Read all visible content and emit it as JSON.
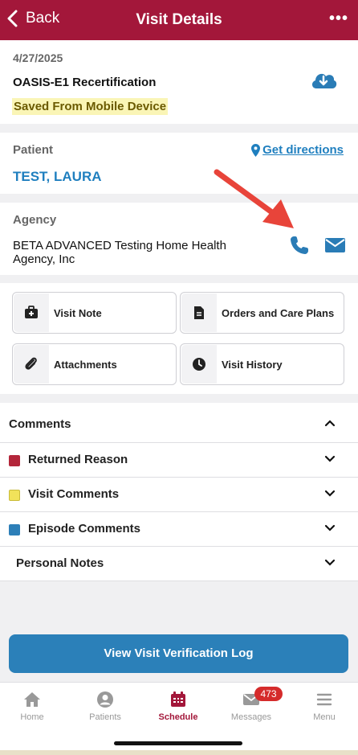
{
  "header": {
    "back_label": "Back",
    "title": "Visit Details",
    "more_label": "•••"
  },
  "visit": {
    "date": "4/27/2025",
    "type": "OASIS-E1 Recertification",
    "status": "Saved From Mobile Device"
  },
  "patient": {
    "label": "Patient",
    "name": "TEST, LAURA",
    "directions_label": "Get directions"
  },
  "agency": {
    "label": "Agency",
    "name": "BETA ADVANCED Testing Home Health Agency, Inc"
  },
  "actions": [
    {
      "label": "Visit Note",
      "icon": "medical-kit-icon"
    },
    {
      "label": "Orders and Care Plans",
      "icon": "document-icon"
    },
    {
      "label": "Attachments",
      "icon": "paperclip-icon"
    },
    {
      "label": "Visit History",
      "icon": "clock-icon"
    }
  ],
  "comments": {
    "title": "Comments",
    "items": [
      {
        "label": "Returned Reason",
        "color": "#b3263a"
      },
      {
        "label": "Visit Comments",
        "color": "#f1e25a"
      },
      {
        "label": "Episode Comments",
        "color": "#2d7fb8"
      },
      {
        "label": "Personal Notes"
      }
    ]
  },
  "verify_button": "View Visit Verification Log",
  "tabs": [
    {
      "label": "Home",
      "icon": "home-icon"
    },
    {
      "label": "Patients",
      "icon": "user-icon"
    },
    {
      "label": "Schedule",
      "icon": "calendar-icon",
      "active": true
    },
    {
      "label": "Messages",
      "icon": "envelope-icon",
      "badge": "473"
    },
    {
      "label": "Menu",
      "icon": "hamburger-icon"
    }
  ],
  "colors": {
    "brand": "#a3173a",
    "link": "#1f7fbf",
    "button": "#2b80b9",
    "badge": "#d52b2b",
    "annotation_arrow": "#e8443a"
  }
}
